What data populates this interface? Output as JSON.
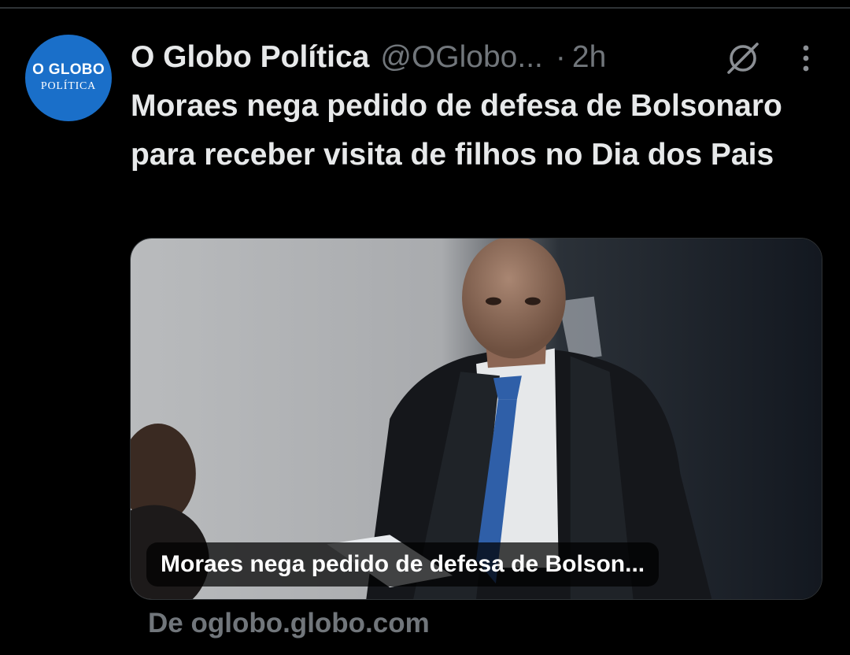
{
  "tweet": {
    "avatar": {
      "line1": "O GLOBO",
      "line2": "POLÍTICA",
      "color": "#1a6fc9"
    },
    "display_name": "O Globo Política",
    "handle": "@OGlobo...",
    "separator": "·",
    "time": "2h",
    "actions": {
      "grok_icon": "grok-icon",
      "more_icon": "more-vertical-icon"
    },
    "text": "Moraes nega pedido de defesa de Bolsonaro para receber visita de filhos no Dia dos Pais",
    "card": {
      "image_icon": "article-photo",
      "caption": "Moraes nega pedido de defesa de Bolson...",
      "source": "De oglobo.globo.com"
    }
  },
  "colors": {
    "background": "#000000",
    "text_primary": "#e7e9ea",
    "text_secondary": "#71767b",
    "divider": "#2f3336"
  }
}
